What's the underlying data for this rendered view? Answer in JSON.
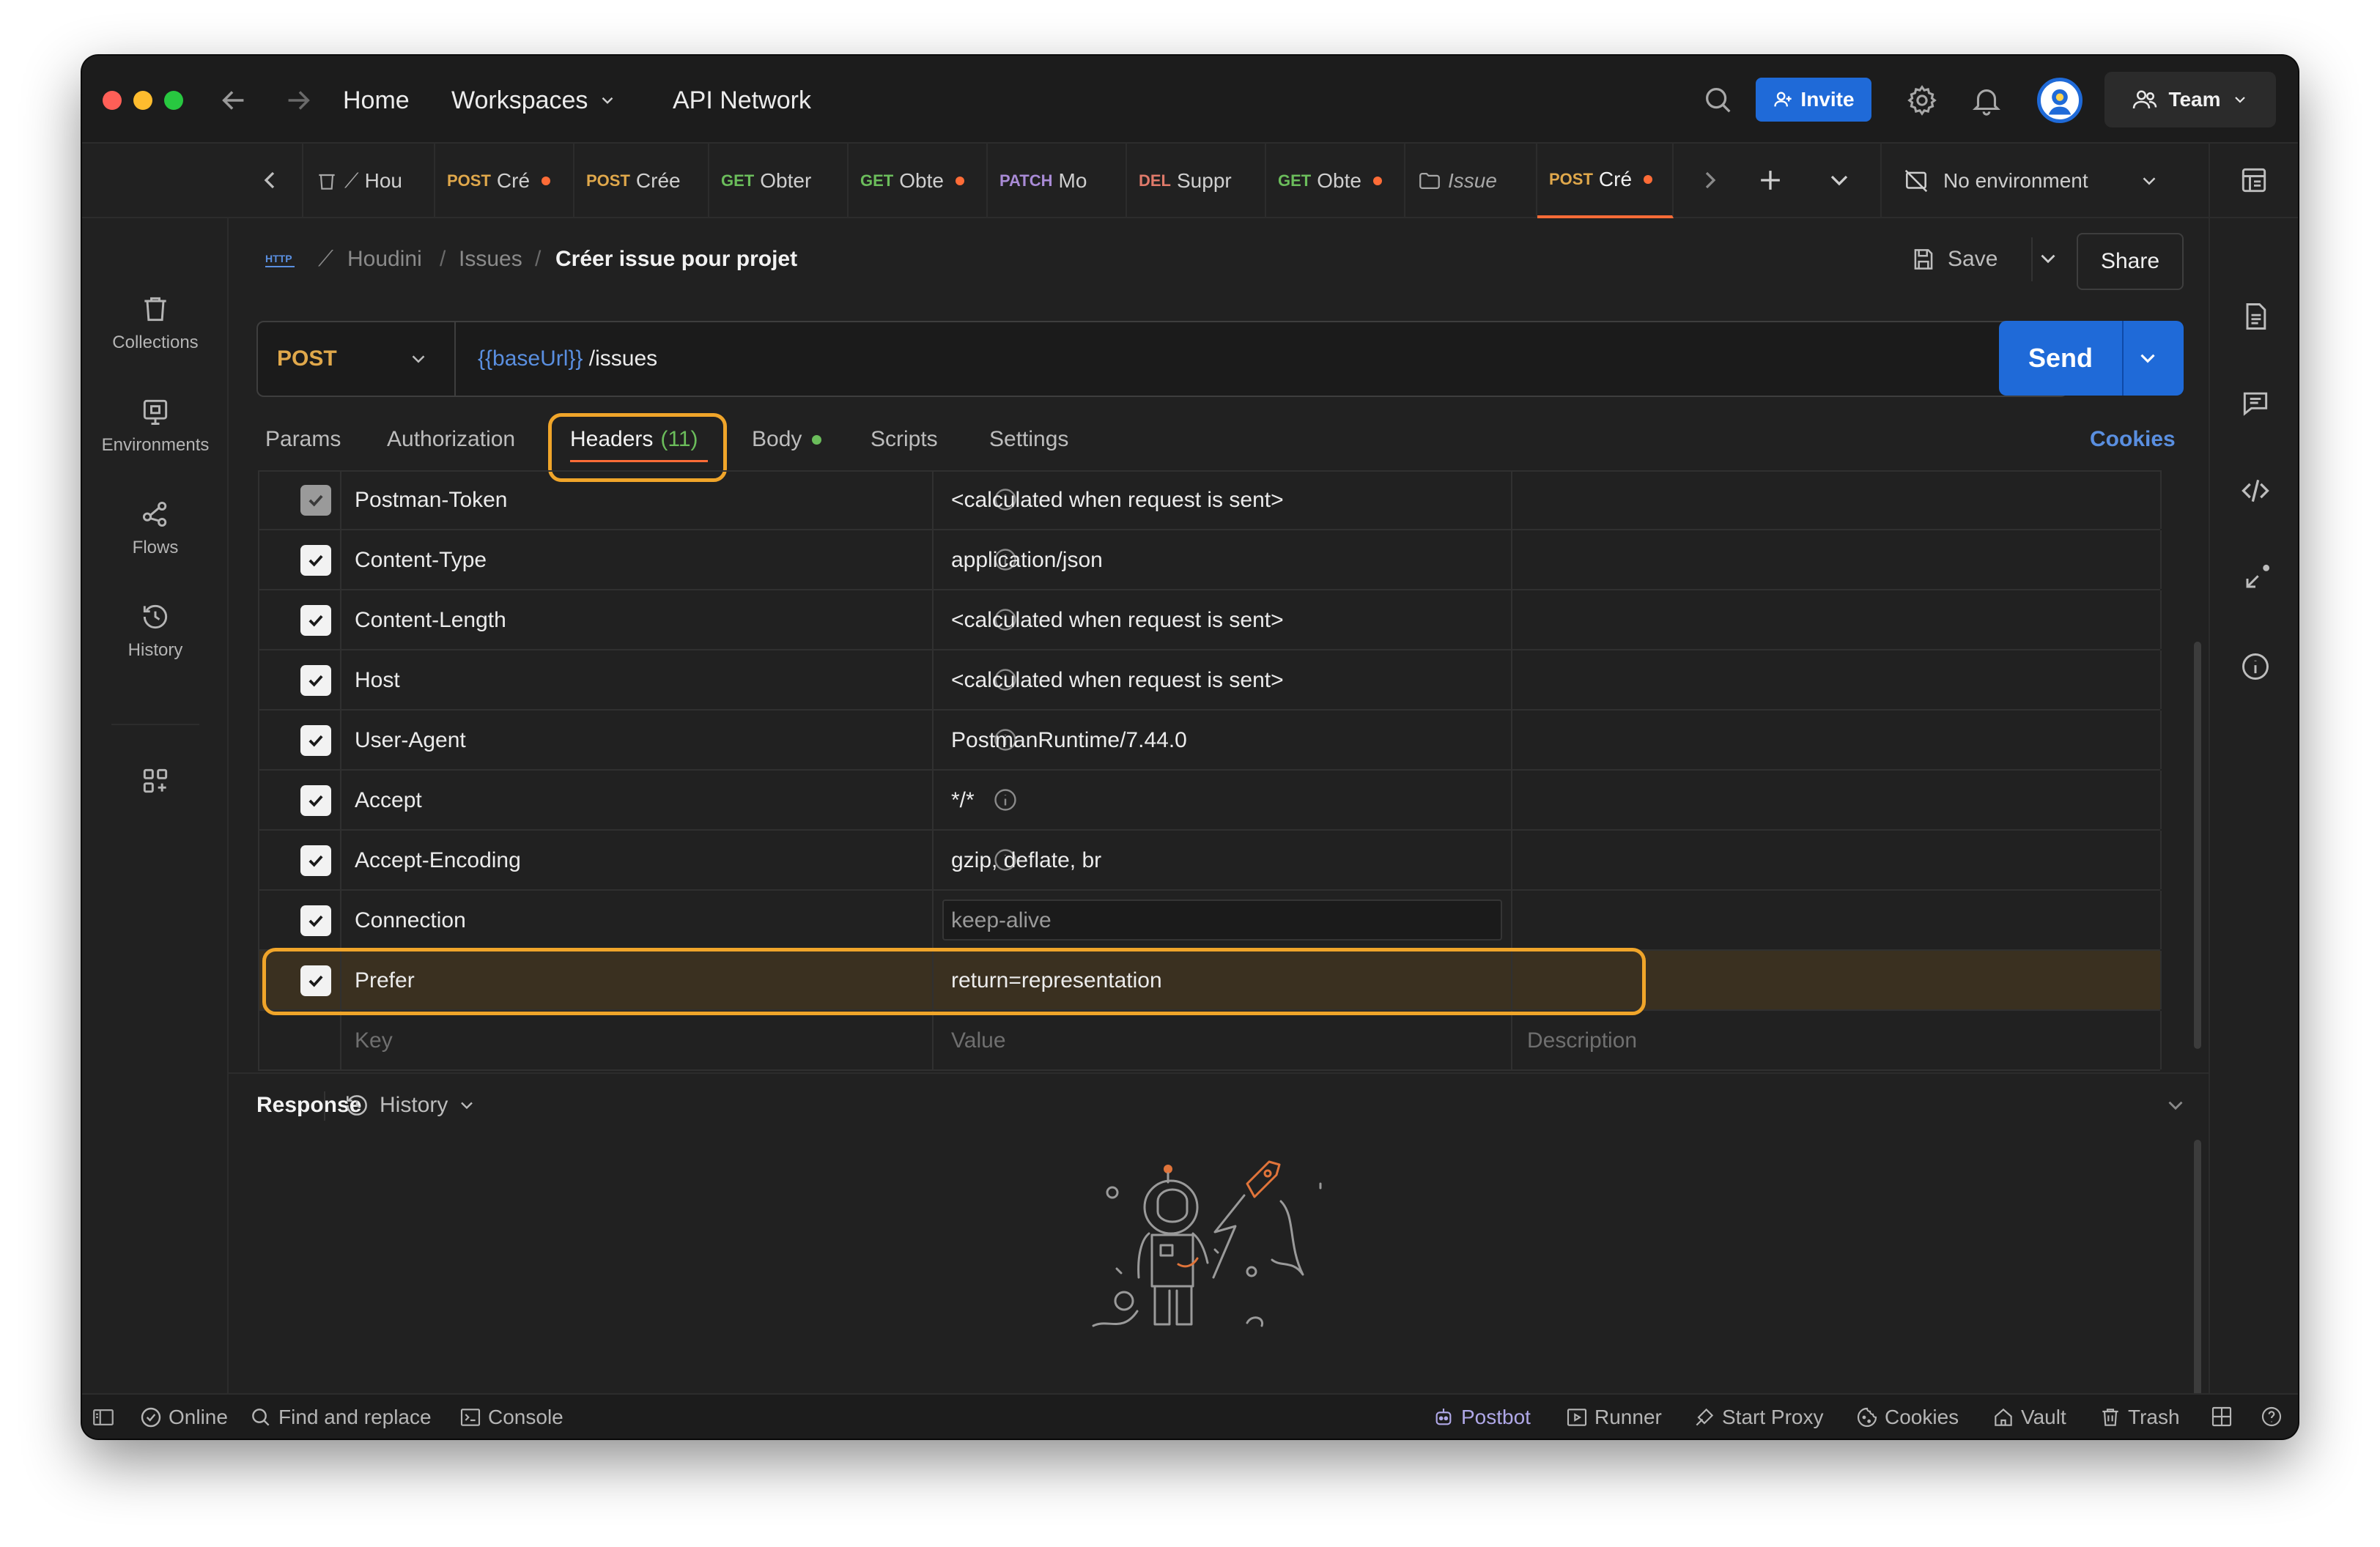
{
  "topbar": {
    "nav_home": "Home",
    "nav_workspaces": "Workspaces",
    "nav_api_network": "API Network",
    "invite_label": "Invite",
    "team_label": "Team"
  },
  "tabs": [
    {
      "method": "",
      "name": "Hou",
      "dot": false
    },
    {
      "method": "POST",
      "name": "Cré",
      "dot": true
    },
    {
      "method": "POST",
      "name": "Crée",
      "dot": false
    },
    {
      "method": "GET",
      "name": "Obter",
      "dot": false
    },
    {
      "method": "GET",
      "name": "Obte",
      "dot": true
    },
    {
      "method": "PATCH",
      "name": "Mo",
      "dot": false
    },
    {
      "method": "DEL",
      "name": "Suppr",
      "dot": false
    },
    {
      "method": "GET",
      "name": "Obte",
      "dot": true
    },
    {
      "method": "",
      "name": "Issue",
      "dot": false
    },
    {
      "method": "POST",
      "name": "Cré",
      "dot": true
    }
  ],
  "environment": "No environment",
  "sidebar": {
    "collections": "Collections",
    "environments": "Environments",
    "flows": "Flows",
    "history": "History"
  },
  "breadcrumb": {
    "workspace": "Houdini",
    "folder": "Issues",
    "request": "Créer issue pour projet",
    "sep": "/"
  },
  "actions": {
    "save": "Save",
    "share": "Share"
  },
  "request": {
    "method": "POST",
    "url_var": "{{baseUrl}}",
    "url_path": " /issues",
    "send": "Send"
  },
  "subtabs": {
    "params": "Params",
    "authorization": "Authorization",
    "headers": "Headers",
    "headers_count": "(11)",
    "body": "Body",
    "scripts": "Scripts",
    "settings": "Settings",
    "cookies": "Cookies"
  },
  "headers": [
    {
      "key": "Postman-Token",
      "value": "<calculated when request is sent>"
    },
    {
      "key": "Content-Type",
      "value": "application/json"
    },
    {
      "key": "Content-Length",
      "value": "<calculated when request is sent>"
    },
    {
      "key": "Host",
      "value": "<calculated when request is sent>"
    },
    {
      "key": "User-Agent",
      "value": "PostmanRuntime/7.44.0"
    },
    {
      "key": "Accept",
      "value": "*/*"
    },
    {
      "key": "Accept-Encoding",
      "value": "gzip, deflate, br"
    },
    {
      "key": "Connection",
      "value": "keep-alive"
    },
    {
      "key": "Prefer",
      "value": "return=representation"
    }
  ],
  "new_row": {
    "key": "Key",
    "value": "Value",
    "description": "Description"
  },
  "response": {
    "label": "Response",
    "history": "History"
  },
  "status": {
    "online": "Online",
    "find_replace": "Find and replace",
    "console": "Console",
    "postbot": "Postbot",
    "runner": "Runner",
    "start_proxy": "Start Proxy",
    "cookies": "Cookies",
    "vault": "Vault",
    "trash": "Trash"
  },
  "colors": {
    "accent": "#ff6c37",
    "primary_blue": "#1f6ad8",
    "highlight": "#f0a52a",
    "background": "#212121"
  }
}
